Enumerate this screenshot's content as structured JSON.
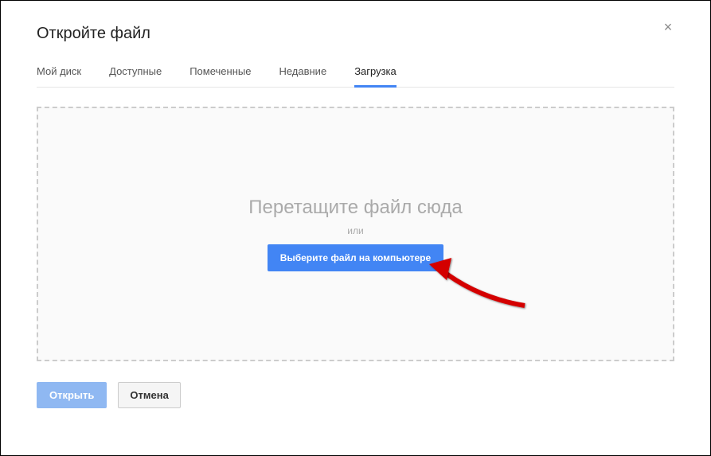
{
  "dialog": {
    "title": "Откройте файл",
    "close": "×"
  },
  "tabs": [
    {
      "label": "Мой диск",
      "active": false
    },
    {
      "label": "Доступные",
      "active": false
    },
    {
      "label": "Помеченные",
      "active": false
    },
    {
      "label": "Недавние",
      "active": false
    },
    {
      "label": "Загрузка",
      "active": true
    }
  ],
  "dropzone": {
    "main_text": "Перетащите файл сюда",
    "or_text": "или",
    "button": "Выберите файл на компьютере"
  },
  "footer": {
    "open": "Открыть",
    "cancel": "Отмена"
  }
}
